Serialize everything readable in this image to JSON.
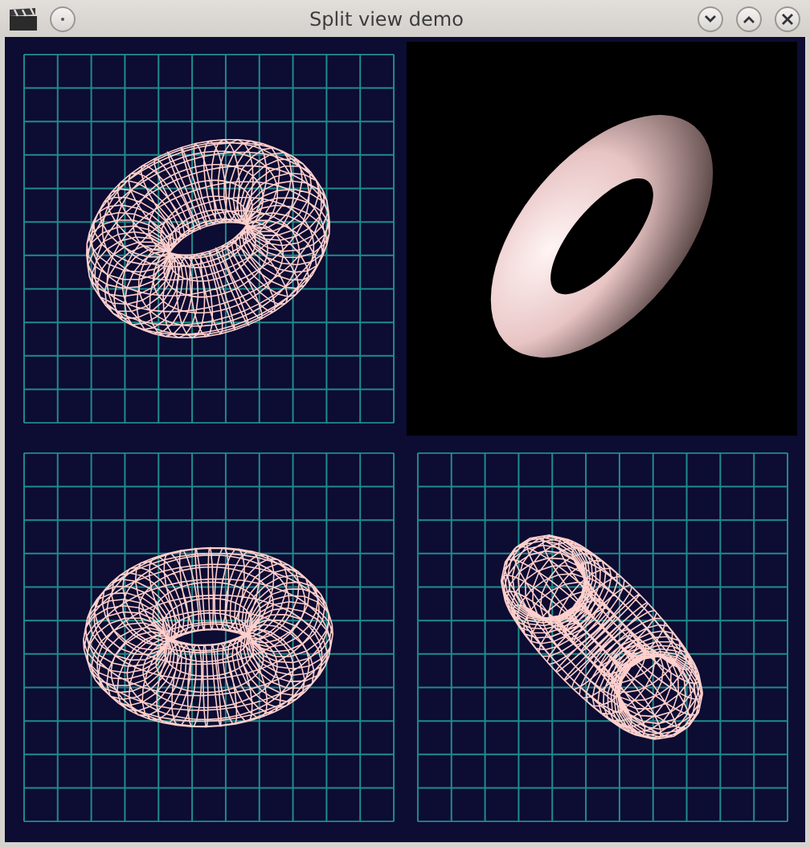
{
  "window": {
    "title": "Split view demo"
  },
  "viewports": [
    {
      "kind": "wireframe"
    },
    {
      "kind": "shaded"
    },
    {
      "kind": "wireframe"
    },
    {
      "kind": "wireframe"
    }
  ]
}
